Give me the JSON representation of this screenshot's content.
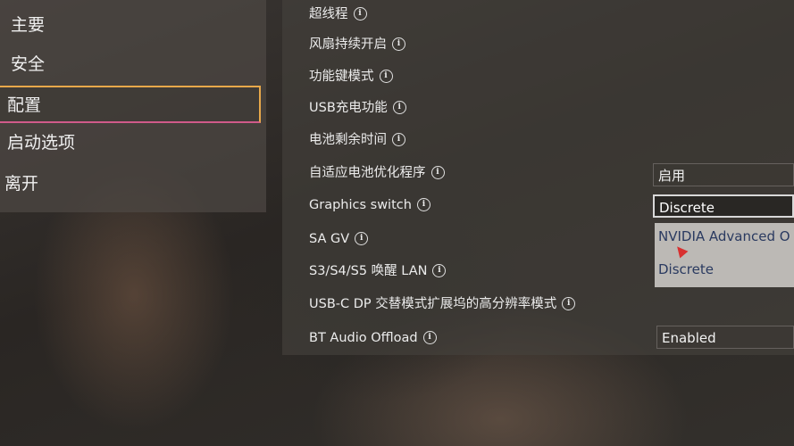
{
  "nav": {
    "items": [
      {
        "label": "主要"
      },
      {
        "label": "安全"
      },
      {
        "label": "配置"
      },
      {
        "label": "启动选项"
      },
      {
        "label": "离开"
      }
    ]
  },
  "settings": {
    "rows": [
      {
        "label": "超线程"
      },
      {
        "label": "风扇持续开启"
      },
      {
        "label": "功能键模式"
      },
      {
        "label": "USB充电功能"
      },
      {
        "label": "电池剩余时间"
      },
      {
        "label": "自适应电池优化程序",
        "value": "启用"
      },
      {
        "label": "Graphics switch",
        "value": "Discrete"
      },
      {
        "label": "SA GV"
      },
      {
        "label": "S3/S4/S5 唤醒 LAN"
      },
      {
        "label": "USB-C DP 交替模式扩展坞的高分辨率模式"
      },
      {
        "label": "BT Audio Offload",
        "value": "Enabled"
      }
    ]
  },
  "dropdown": {
    "options": [
      {
        "label": "NVIDIA Advanced O"
      },
      {
        "label": "Discrete"
      }
    ]
  },
  "info_glyph": "i",
  "colors": {
    "selected_border_top": "#e8a84a",
    "selected_border_bottom": "#d05a8a",
    "dropdown_bg": "#c8c4c0",
    "dropdown_text": "#2a3a60"
  }
}
